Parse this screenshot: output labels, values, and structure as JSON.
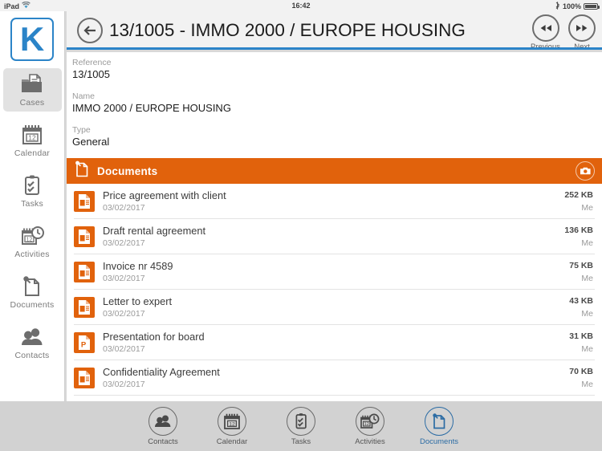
{
  "statusbar": {
    "device": "iPad",
    "wifi_icon": "wifi-icon",
    "time": "16:42",
    "bluetooth_icon": "bluetooth-icon",
    "battery_percent": "100%",
    "battery_icon": "battery-full-icon"
  },
  "brand": {
    "logo_letter": "K",
    "accent_blue": "#2b84c8",
    "accent_orange": "#e1620c",
    "tab_selected_blue": "#2c6ca4"
  },
  "sidebar": {
    "items": [
      {
        "label": "Cases",
        "icon": "folder-document-icon",
        "active": true
      },
      {
        "label": "Calendar",
        "icon": "calendar-12-icon",
        "active": false
      },
      {
        "label": "Tasks",
        "icon": "clipboard-check-icon",
        "active": false
      },
      {
        "label": "Activities",
        "icon": "clock-calendar-icon",
        "active": false
      },
      {
        "label": "Documents",
        "icon": "document-pin-icon",
        "active": false
      },
      {
        "label": "Contacts",
        "icon": "people-icon",
        "active": false
      }
    ]
  },
  "navbar": {
    "back_icon": "arrow-left-circle-icon",
    "title": "13/1005 - IMMO 2000 / EUROPE HOUSING",
    "previous": {
      "label": "Previous",
      "icon": "rewind-icon"
    },
    "next": {
      "label": "Next",
      "icon": "fast-forward-icon"
    }
  },
  "detail": {
    "fields": [
      {
        "label": "Reference",
        "value": "13/1005"
      },
      {
        "label": "Name",
        "value": "IMMO 2000 / EUROPE HOUSING"
      },
      {
        "label": "Type",
        "value": "General"
      }
    ]
  },
  "documents_section": {
    "title": "Documents",
    "header_icon": "document-pin-icon",
    "camera_button": "camera-icon",
    "rows": [
      {
        "icon": "word-document-icon",
        "title": "Price agreement with client",
        "date": "03/02/2017",
        "size": "252 KB",
        "owner": "Me"
      },
      {
        "icon": "word-document-icon",
        "title": "Draft rental agreement",
        "date": "03/02/2017",
        "size": "136 KB",
        "owner": "Me"
      },
      {
        "icon": "word-document-icon",
        "title": "Invoice nr 4589",
        "date": "03/02/2017",
        "size": "75 KB",
        "owner": "Me"
      },
      {
        "icon": "word-document-icon",
        "title": "Letter to expert",
        "date": "03/02/2017",
        "size": "43 KB",
        "owner": "Me"
      },
      {
        "icon": "powerpoint-document-icon",
        "title": "Presentation for board",
        "date": "03/02/2017",
        "size": "31 KB",
        "owner": "Me"
      },
      {
        "icon": "word-document-icon",
        "title": "Confidentiality Agreement",
        "date": "03/02/2017",
        "size": "70 KB",
        "owner": "Me"
      }
    ]
  },
  "tabbar": {
    "tabs": [
      {
        "label": "Contacts",
        "icon": "people-icon",
        "active": false
      },
      {
        "label": "Calendar",
        "icon": "calendar-12-icon",
        "active": false
      },
      {
        "label": "Tasks",
        "icon": "clipboard-check-icon",
        "active": false
      },
      {
        "label": "Activities",
        "icon": "clock-calendar-icon",
        "active": false
      },
      {
        "label": "Documents",
        "icon": "document-pin-icon",
        "active": true
      }
    ]
  }
}
